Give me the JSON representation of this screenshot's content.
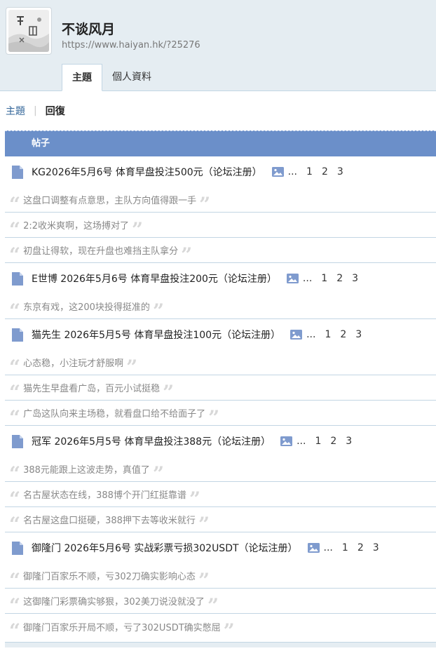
{
  "site": {
    "name": "不谈风月",
    "url": "https://www.haiyan.hk/?25276"
  },
  "tabs": [
    {
      "label": "主題",
      "active": true
    },
    {
      "label": "個人資料",
      "active": false
    }
  ],
  "subnav": {
    "topics_label": "主題",
    "separator": "|",
    "replies_label": "回復"
  },
  "table_header": "帖子",
  "threads": [
    {
      "title": "KG2026年5月6号 体育早盘投注500元（论坛注册）",
      "ellipsis": "...",
      "pages": [
        "1",
        "2",
        "3"
      ],
      "replies": [
        "这盘口调整有点意思，主队方向值得跟一手",
        "2:2收米爽啊，这场搏对了",
        "初盘让得软，现在升盘也难挡主队拿分"
      ]
    },
    {
      "title": "E世博 2026年5月6号 体育早盘投注200元（论坛注册）",
      "ellipsis": "...",
      "pages": [
        "1",
        "2",
        "3"
      ],
      "replies": [
        "东京有戏，这200块投得挺准的"
      ]
    },
    {
      "title": "猫先生 2026年5月5号 体育早盘投注100元（论坛注册）",
      "ellipsis": "...",
      "pages": [
        "1",
        "2",
        "3"
      ],
      "replies": [
        "心态稳，小注玩才舒服啊",
        "猫先生早盘看广岛，百元小试挺稳",
        "广岛这队向来主场稳，就看盘口给不给面子了"
      ]
    },
    {
      "title": "冠军 2026年5月5号 体育早盘投注388元（论坛注册）",
      "ellipsis": "...",
      "pages": [
        "1",
        "2",
        "3"
      ],
      "replies": [
        "388元能跟上这波走势，真值了",
        "名古屋状态在线，388博个开门红挺靠谱",
        "名古屋这盘口挺硬，388押下去等收米就行"
      ]
    },
    {
      "title": "御隆门 2026年5月6号 实战彩票亏损302USDT（论坛注册）",
      "ellipsis": "...",
      "pages": [
        "1",
        "2",
        "3"
      ],
      "replies": [
        "御隆门百家乐不顺，亏302刀确实影响心态",
        "这御隆门彩票确实够狠，302美刀说没就没了",
        "御隆门百家乐开局不顺，亏了302USDT确实憋屈"
      ]
    }
  ],
  "colors": {
    "header_bg": "#e5edf2",
    "table_header_bg": "#6b8fc9",
    "border": "#c2d5e3",
    "link": "#336699"
  }
}
